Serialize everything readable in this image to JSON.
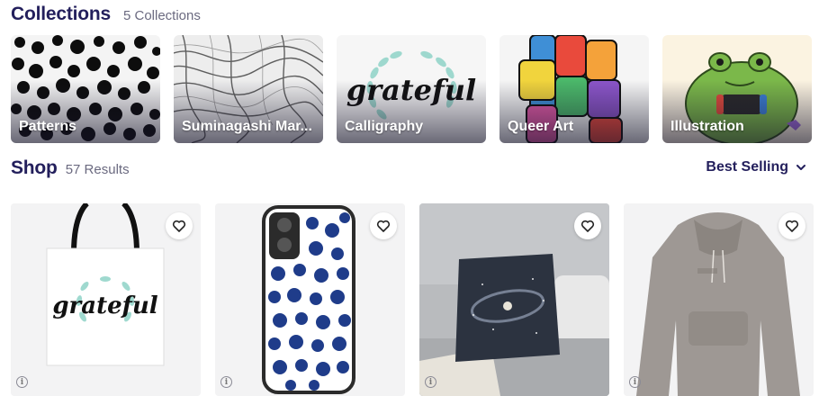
{
  "collections": {
    "title": "Collections",
    "count": "5 Collections",
    "items": [
      {
        "label": "Patterns"
      },
      {
        "label": "Suminagashi Mar..."
      },
      {
        "label": "Calligraphy",
        "art_text": "grateful"
      },
      {
        "label": "Queer Art"
      },
      {
        "label": "Illustration"
      }
    ]
  },
  "shop": {
    "title": "Shop",
    "count": "57 Results",
    "sort_label": "Best Selling",
    "products": [
      {
        "name": "tote-bag",
        "art_text": "grateful"
      },
      {
        "name": "phone-case"
      },
      {
        "name": "throw-pillow"
      },
      {
        "name": "hoodie"
      }
    ]
  },
  "colors": {
    "heading": "#231f5c",
    "muted": "#6b6a80",
    "card_bg": "#f3f3f4"
  }
}
